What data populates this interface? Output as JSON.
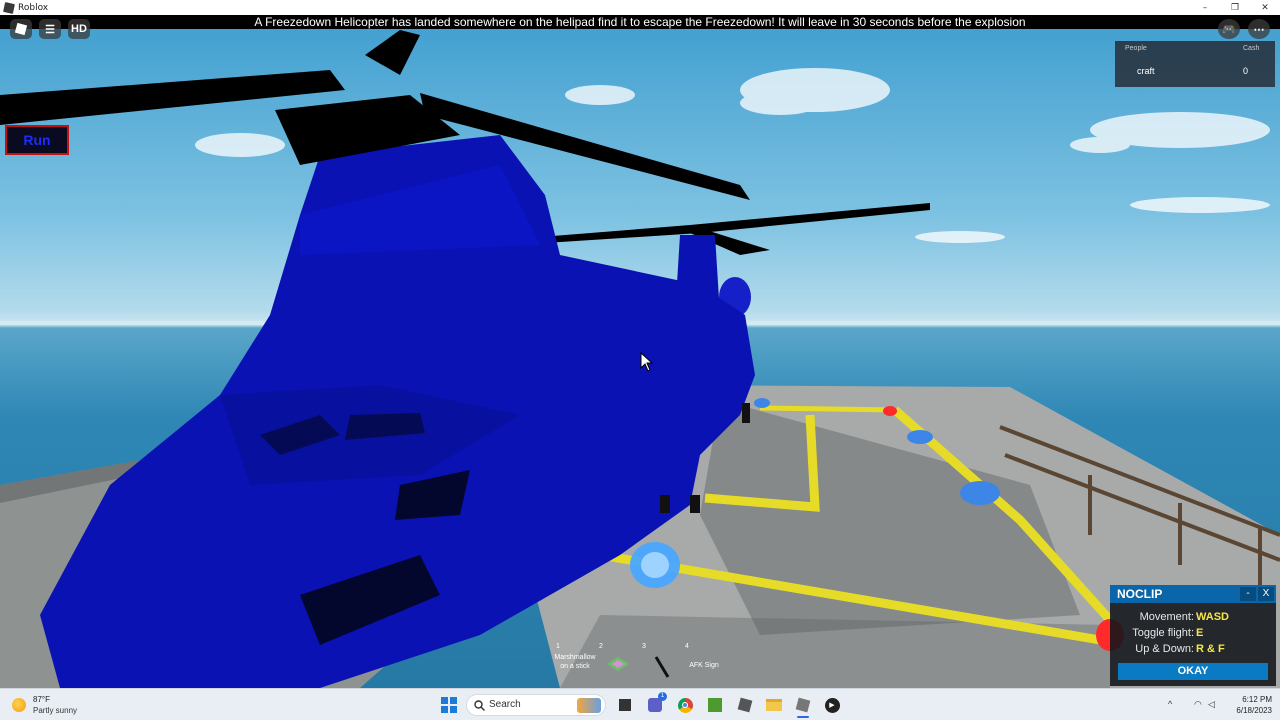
{
  "window": {
    "title": "Roblox",
    "minimize": "–",
    "maximize": "❐",
    "close": "✕"
  },
  "topbar": {
    "announcement": "A Freezedown Helicopter has landed somewhere on the helipad find it to escape the Freezedown! It will leave in 30 seconds before the explosion",
    "hd_label": "HD"
  },
  "leaderboard": {
    "col_people": "People",
    "col_cash": "Cash",
    "player_name": "craft",
    "player_cash": "0"
  },
  "run_button": {
    "label": "Run"
  },
  "noclip": {
    "title": "NOCLIP",
    "minimize": "-",
    "close": "X",
    "rows": [
      {
        "label": "Movement:",
        "value": "WASD"
      },
      {
        "label": "Toggle flight:",
        "value": "E"
      },
      {
        "label": "Up & Down:",
        "value": "R & F"
      }
    ],
    "okay": "OKAY"
  },
  "hotbar": [
    {
      "num": "1",
      "label": "Marshmallow on a stick"
    },
    {
      "num": "2",
      "label": ""
    },
    {
      "num": "3",
      "label": ""
    },
    {
      "num": "4",
      "label": "AFK Sign"
    }
  ],
  "taskbar": {
    "weather_temp": "87°F",
    "weather_cond": "Partly sunny",
    "search_label": "Search",
    "time": "6:12 PM",
    "date": "6/18/2023",
    "chat_badge": "1"
  },
  "colors": {
    "helicopter": "#0a12b4",
    "helipad_line": "#e6dc28",
    "noclip_header": "#0a66a8",
    "run_border": "#c41212"
  }
}
